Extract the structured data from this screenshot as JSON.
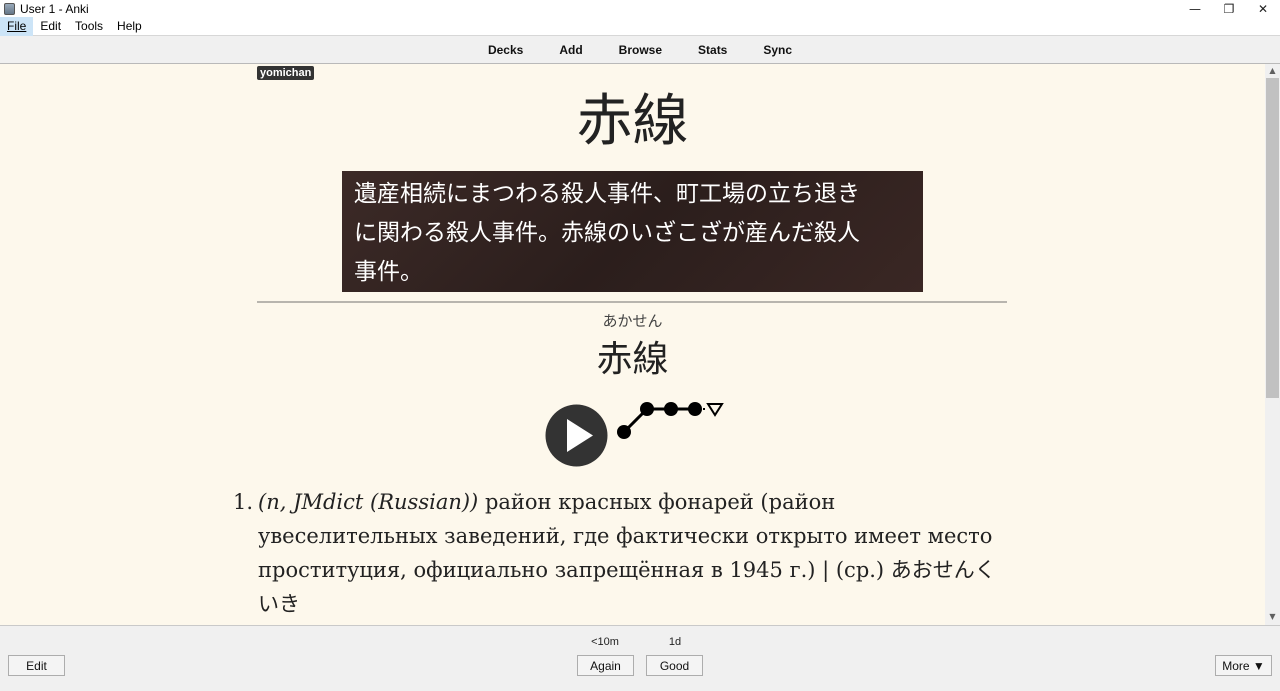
{
  "window": {
    "title": "User 1 - Anki",
    "controls": [
      "—",
      "❐",
      "✕"
    ]
  },
  "menu": [
    {
      "label": "File",
      "mnemonic": "F"
    },
    {
      "label": "Edit",
      "mnemonic": "E"
    },
    {
      "label": "Tools",
      "mnemonic": "T"
    },
    {
      "label": "Help",
      "mnemonic": "H"
    }
  ],
  "toolbar": {
    "decks": "Decks",
    "add": "Add",
    "browse": "Browse",
    "stats": "Stats",
    "sync": "Sync"
  },
  "card": {
    "tag": "yomichan",
    "front_word": "赤線",
    "sentence": [
      "遺産相続にまつわる殺人事件、町工場の立ち退き",
      "に関わる殺人事件。赤線のいざこざが産んだ殺人",
      "事件。"
    ],
    "reading": "あかせん",
    "back_word": "赤線",
    "definition": {
      "number": "1.",
      "tag": "(n, JMdict (Russian))",
      "text": " район красных фонарей (район увеселительных заведений, где фактически открыто имеет место проституция, официально запрещённая в 1945 г.) | (ср.) あおせんくいき"
    }
  },
  "footer": {
    "edit": "Edit",
    "again_interval": "<10m",
    "good_interval": "1d",
    "again": "Again",
    "good": "Good",
    "more": "More ▼"
  }
}
